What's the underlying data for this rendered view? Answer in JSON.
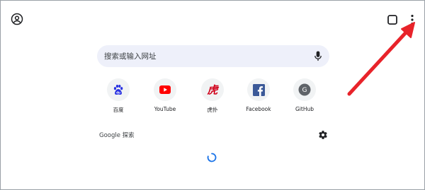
{
  "toolbar": {
    "account_icon": "account-circle-icon",
    "tabs_icon": "tab-switcher-icon",
    "menu_icon": "more-vert-icon"
  },
  "search": {
    "placeholder": "搜索或输入网址",
    "mic_icon": "microphone-icon"
  },
  "shortcuts": [
    {
      "label": "百度",
      "icon": "baidu-paw-icon",
      "color": "#2932e1"
    },
    {
      "label": "YouTube",
      "icon": "youtube-icon",
      "color": "#ff0000"
    },
    {
      "label": "虎扑",
      "icon": "hupu-icon",
      "color": "#d0021b"
    },
    {
      "label": "Facebook",
      "icon": "facebook-icon",
      "color": "#3b5998"
    },
    {
      "label": "GitHub",
      "icon": "github-letter-icon",
      "letter": "G",
      "color": "#5f6368"
    }
  ],
  "feed": {
    "title": "Google 探索",
    "settings_icon": "gear-icon"
  },
  "colors": {
    "search_bg": "#eef0fa",
    "tile_bg": "#f1f3f4",
    "spinner": "#1a73e8",
    "annotation_arrow": "#e8232a"
  }
}
